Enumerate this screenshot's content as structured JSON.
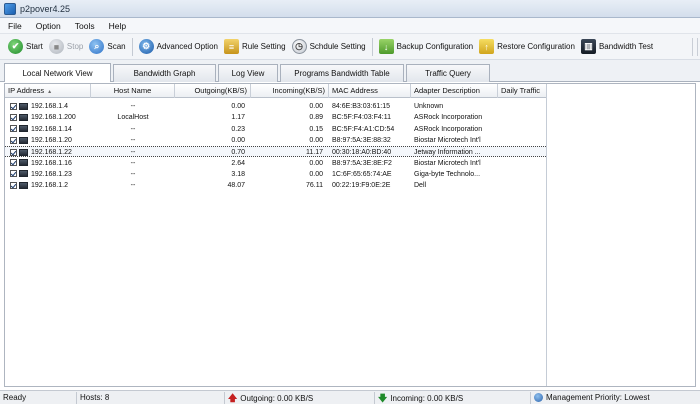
{
  "window": {
    "title": "p2pover4.25"
  },
  "menu": [
    "File",
    "Option",
    "Tools",
    "Help"
  ],
  "toolbar": {
    "start": "Start",
    "stop": "Stop",
    "scan": "Scan",
    "advanced_option": "Advanced Option",
    "rule_setting": "Rule Setting",
    "schedule_setting": "Schdule Setting",
    "backup_configuration": "Backup Configuration",
    "restore_configuration": "Restore Configuration",
    "bandwidth_test": "Bandwidth Test"
  },
  "tabs": [
    "Local Network View",
    "Bandwidth Graph",
    "Log View",
    "Programs Bandwidth Table",
    "Traffic Query"
  ],
  "active_tab": "Local Network View",
  "table": {
    "columns": [
      "IP Address",
      "Host Name",
      "Outgoing(KB/S)",
      "Incoming(KB/S)",
      "MAC Address",
      "Adapter Description",
      "Daily Traffic"
    ],
    "rows": [
      {
        "ip": "192.168.1.4",
        "host": "--",
        "out": "0.00",
        "in": "0.00",
        "mac": "84:6E:B3:03:61:15",
        "adapter": "Unknown"
      },
      {
        "ip": "192.168.1.200",
        "host": "LocalHost",
        "out": "1.17",
        "in": "0.89",
        "mac": "BC:5F:F4:03:F4:11",
        "adapter": "ASRock Incorporation"
      },
      {
        "ip": "192.168.1.14",
        "host": "--",
        "out": "0.23",
        "in": "0.15",
        "mac": "BC:5F:F4:A1:CD:54",
        "adapter": "ASRock Incorporation"
      },
      {
        "ip": "192.168.1.20",
        "host": "--",
        "out": "0.00",
        "in": "0.00",
        "mac": "B8:97:5A:3E:88:32",
        "adapter": "Biostar Microtech Int'l"
      },
      {
        "ip": "192.168.1.22",
        "host": "--",
        "out": "0.70",
        "in": "11.17",
        "mac": "00:30:18:A0:BD:40",
        "adapter": "Jetway Information ..."
      },
      {
        "ip": "192.168.1.16",
        "host": "--",
        "out": "2.64",
        "in": "0.00",
        "mac": "B8:97:5A:3E:8E:F2",
        "adapter": "Biostar Microtech Int'l"
      },
      {
        "ip": "192.168.1.23",
        "host": "--",
        "out": "3.18",
        "in": "0.00",
        "mac": "1C:6F:65:65:74:AE",
        "adapter": "Giga-byte Technolo..."
      },
      {
        "ip": "192.168.1.2",
        "host": "--",
        "out": "48.07",
        "in": "76.11",
        "mac": "00:22:19:F9:0E:2E",
        "adapter": "Dell"
      }
    ],
    "selected_ip": "192.168.1.22"
  },
  "status": {
    "ready": "Ready",
    "hosts": "Hosts: 8",
    "outgoing": "Outgoing: 0.00 KB/S",
    "incoming": "Incoming: 0.00 KB/S",
    "priority": "Management Priority: Lowest"
  },
  "icons": {
    "start": "start-icon",
    "stop": "stop-icon",
    "scan": "scan-icon",
    "advanced_option": "globe-gear-icon",
    "rule_setting": "rule-icon",
    "schedule_setting": "clock-icon",
    "backup_configuration": "backup-icon",
    "restore_configuration": "restore-icon",
    "bandwidth_test": "bandwidth-icon"
  }
}
